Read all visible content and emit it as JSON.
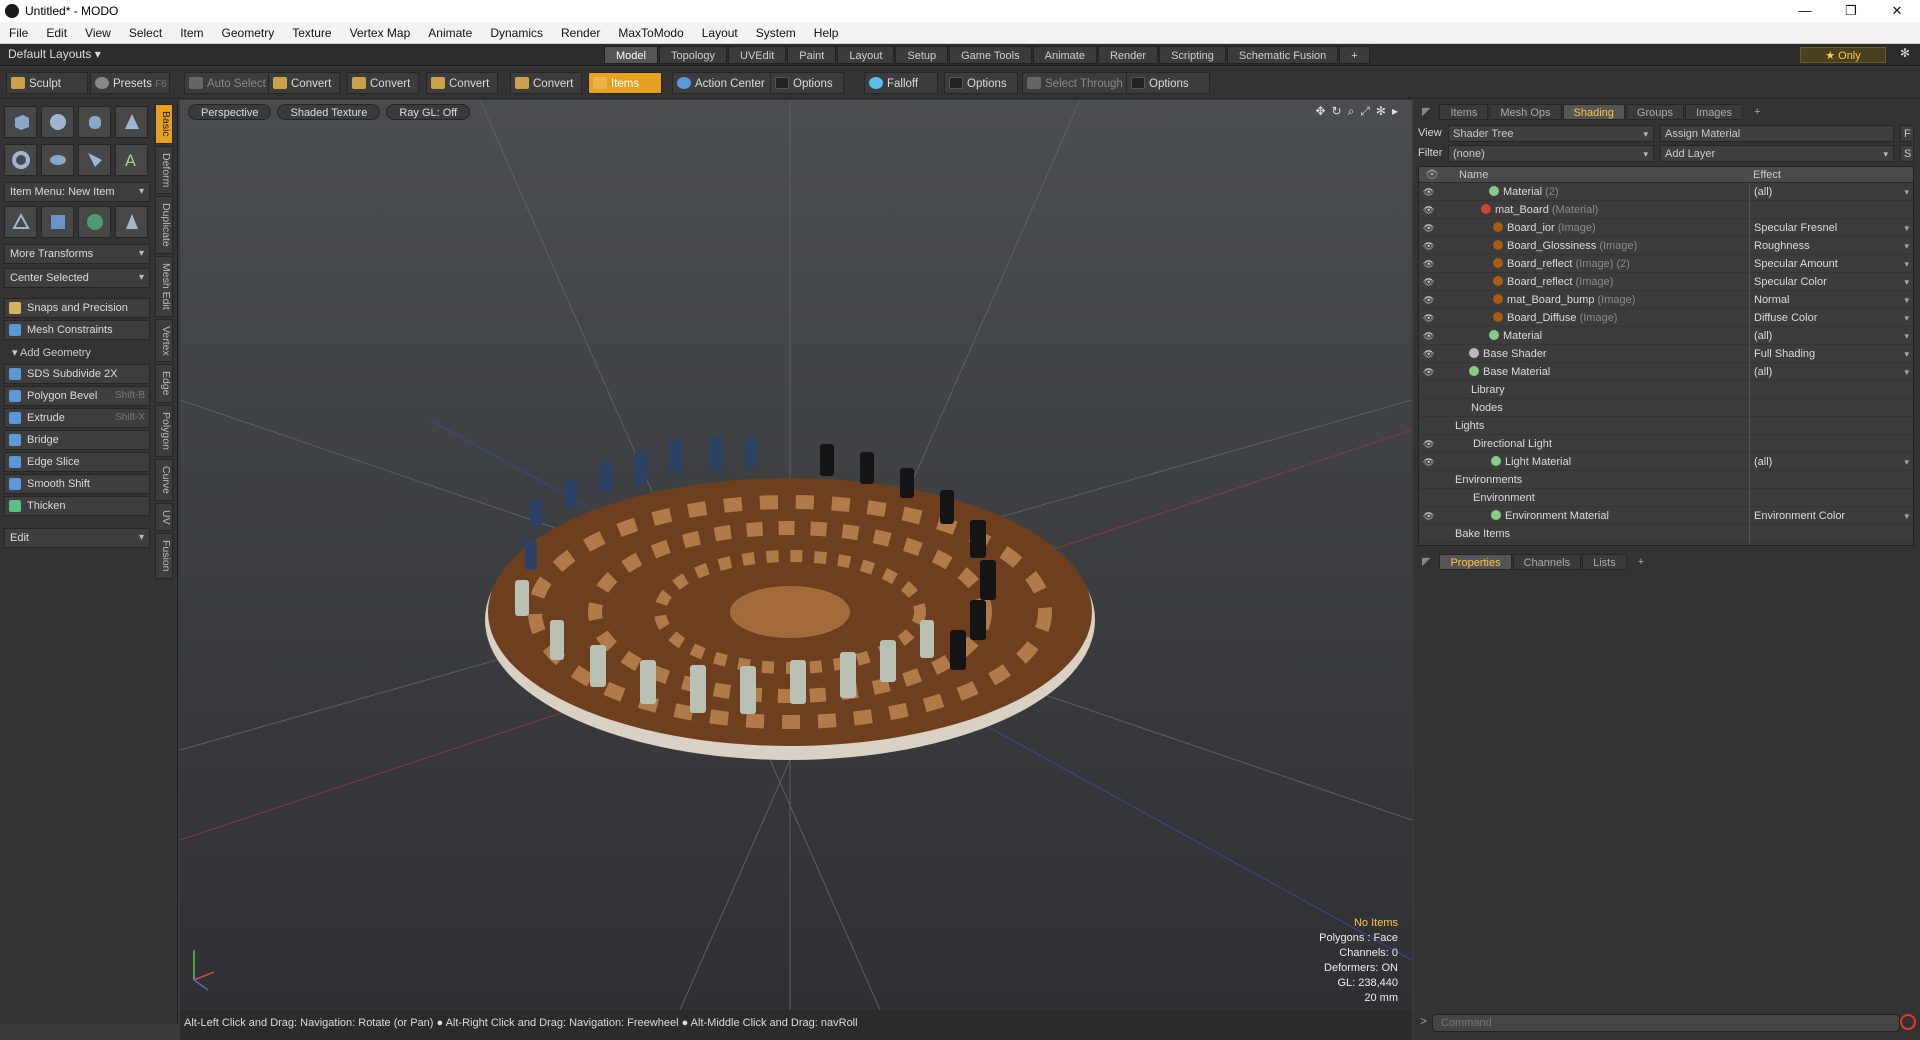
{
  "window": {
    "title": "Untitled* - MODO",
    "controls": [
      "—",
      "❐",
      "✕"
    ]
  },
  "menu": [
    "File",
    "Edit",
    "View",
    "Select",
    "Item",
    "Geometry",
    "Texture",
    "Vertex Map",
    "Animate",
    "Dynamics",
    "Render",
    "MaxToModo",
    "Layout",
    "System",
    "Help"
  ],
  "layout_tabs": {
    "layouts": "Default Layouts ▾",
    "tabs": [
      "Model",
      "Topology",
      "UVEdit",
      "Paint",
      "Layout",
      "Setup",
      "Game Tools",
      "Animate",
      "Render",
      "Scripting",
      "Schematic Fusion",
      "+"
    ],
    "active": "Model",
    "only": "★ Only"
  },
  "toolbar": {
    "sculpt": "Sculpt",
    "presets": "Presets",
    "presets_key": "F6",
    "auto_select": "Auto Select",
    "convert1": "Convert",
    "convert2": "Convert",
    "convert3": "Convert",
    "convert4": "Convert",
    "items": "Items",
    "action_center": "Action Center",
    "options1": "Options",
    "falloff": "Falloff",
    "options2": "Options",
    "select_through": "Select Through",
    "options3": "Options"
  },
  "left": {
    "item_menu": "Item Menu: New Item",
    "more_transforms": "More Transforms",
    "center_selected": "Center Selected",
    "snaps": "Snaps and Precision",
    "mesh_constraints": "Mesh Constraints",
    "add_geometry": "Add Geometry",
    "tools": [
      {
        "label": "SDS Subdivide 2X",
        "key": ""
      },
      {
        "label": "Polygon Bevel",
        "key": "Shift-B"
      },
      {
        "label": "Extrude",
        "key": "Shift-X"
      },
      {
        "label": "Bridge",
        "key": ""
      },
      {
        "label": "Edge Slice",
        "key": ""
      },
      {
        "label": "Smooth Shift",
        "key": ""
      },
      {
        "label": "Thicken",
        "key": ""
      }
    ],
    "edit": "Edit",
    "vtabs": [
      "Basic",
      "Deform",
      "Duplicate",
      "Mesh Edit",
      "Vertex",
      "Edge",
      "Polygon",
      "Curve",
      "UV",
      "Fusion"
    ]
  },
  "viewport": {
    "perspective": "Perspective",
    "shading": "Shaded Texture",
    "raygl": "Ray GL: Off",
    "info": {
      "no_items": "No Items",
      "polygons": "Polygons : Face",
      "channels": "Channels: 0",
      "deformers": "Deformers: ON",
      "gl": "GL: 238,440",
      "unit": "20 mm"
    }
  },
  "status": "Alt-Left Click and Drag: Navigation: Rotate (or Pan) ● Alt-Right Click and Drag: Navigation: Freewheel ● Alt-Middle Click and Drag: navRoll",
  "right": {
    "tabs": [
      "Items",
      "Mesh Ops",
      "Shading",
      "Groups",
      "Images",
      "+"
    ],
    "active_tab": "Shading",
    "view_label": "View",
    "view_value": "Shader Tree",
    "assign_material": "Assign Material",
    "f_btn": "F",
    "filter_label": "Filter",
    "filter_value": "(none)",
    "add_layer": "Add Layer",
    "s_btn": "S",
    "col_name": "Name",
    "col_effect": "Effect",
    "rows": [
      {
        "name": "Material",
        "suffix": " (2)",
        "effect": "(all)",
        "ball": "green",
        "indent": 70,
        "eye": true
      },
      {
        "name": "mat_Board",
        "suffix": " (Material)",
        "effect": "",
        "ball": "red",
        "indent": 62,
        "eye": true
      },
      {
        "name": "Board_ior",
        "suffix": " (Image)",
        "effect": "Specular Fresnel",
        "ball": "img",
        "indent": 74,
        "eye": true
      },
      {
        "name": "Board_Glossiness",
        "suffix": " (Image)",
        "effect": "Roughness",
        "ball": "img",
        "indent": 74,
        "eye": true
      },
      {
        "name": "Board_reflect",
        "suffix": " (Image) (2)",
        "effect": "Specular Amount",
        "ball": "img",
        "indent": 74,
        "eye": true
      },
      {
        "name": "Board_reflect",
        "suffix": " (Image)",
        "effect": "Specular Color",
        "ball": "img",
        "indent": 74,
        "eye": true
      },
      {
        "name": "mat_Board_bump",
        "suffix": " (Image)",
        "effect": "Normal",
        "ball": "img",
        "indent": 74,
        "eye": true
      },
      {
        "name": "Board_Diffuse",
        "suffix": " (Image)",
        "effect": "Diffuse Color",
        "ball": "img",
        "indent": 74,
        "eye": true
      },
      {
        "name": "Material",
        "suffix": "",
        "effect": "(all)",
        "ball": "green",
        "indent": 70,
        "eye": true
      },
      {
        "name": "Base Shader",
        "suffix": "",
        "effect": "Full Shading",
        "ball": "grey",
        "indent": 50,
        "eye": true
      },
      {
        "name": "Base Material",
        "suffix": "",
        "effect": "(all)",
        "ball": "green",
        "indent": 50,
        "eye": true
      },
      {
        "name": "Library",
        "suffix": "",
        "effect": "",
        "ball": "",
        "indent": 52,
        "eye": false
      },
      {
        "name": "Nodes",
        "suffix": "",
        "effect": "",
        "ball": "",
        "indent": 52,
        "eye": false
      },
      {
        "name": "Lights",
        "suffix": "",
        "effect": "",
        "ball": "",
        "indent": 36,
        "eye": false
      },
      {
        "name": "Directional Light",
        "suffix": "",
        "effect": "",
        "ball": "",
        "indent": 54,
        "eye": true
      },
      {
        "name": "Light Material",
        "suffix": "",
        "effect": "(all)",
        "ball": "green",
        "indent": 72,
        "eye": true
      },
      {
        "name": "Environments",
        "suffix": "",
        "effect": "",
        "ball": "",
        "indent": 36,
        "eye": false
      },
      {
        "name": "Environment",
        "suffix": "",
        "effect": "",
        "ball": "",
        "indent": 54,
        "eye": false
      },
      {
        "name": "Environment Material",
        "suffix": "",
        "effect": "Environment Color",
        "ball": "green",
        "indent": 72,
        "eye": true
      },
      {
        "name": "Bake Items",
        "suffix": "",
        "effect": "",
        "ball": "",
        "indent": 36,
        "eye": false
      }
    ],
    "prop_tabs": [
      "Properties",
      "Channels",
      "Lists",
      "+"
    ],
    "prop_active": "Properties",
    "command_placeholder": "Command"
  }
}
